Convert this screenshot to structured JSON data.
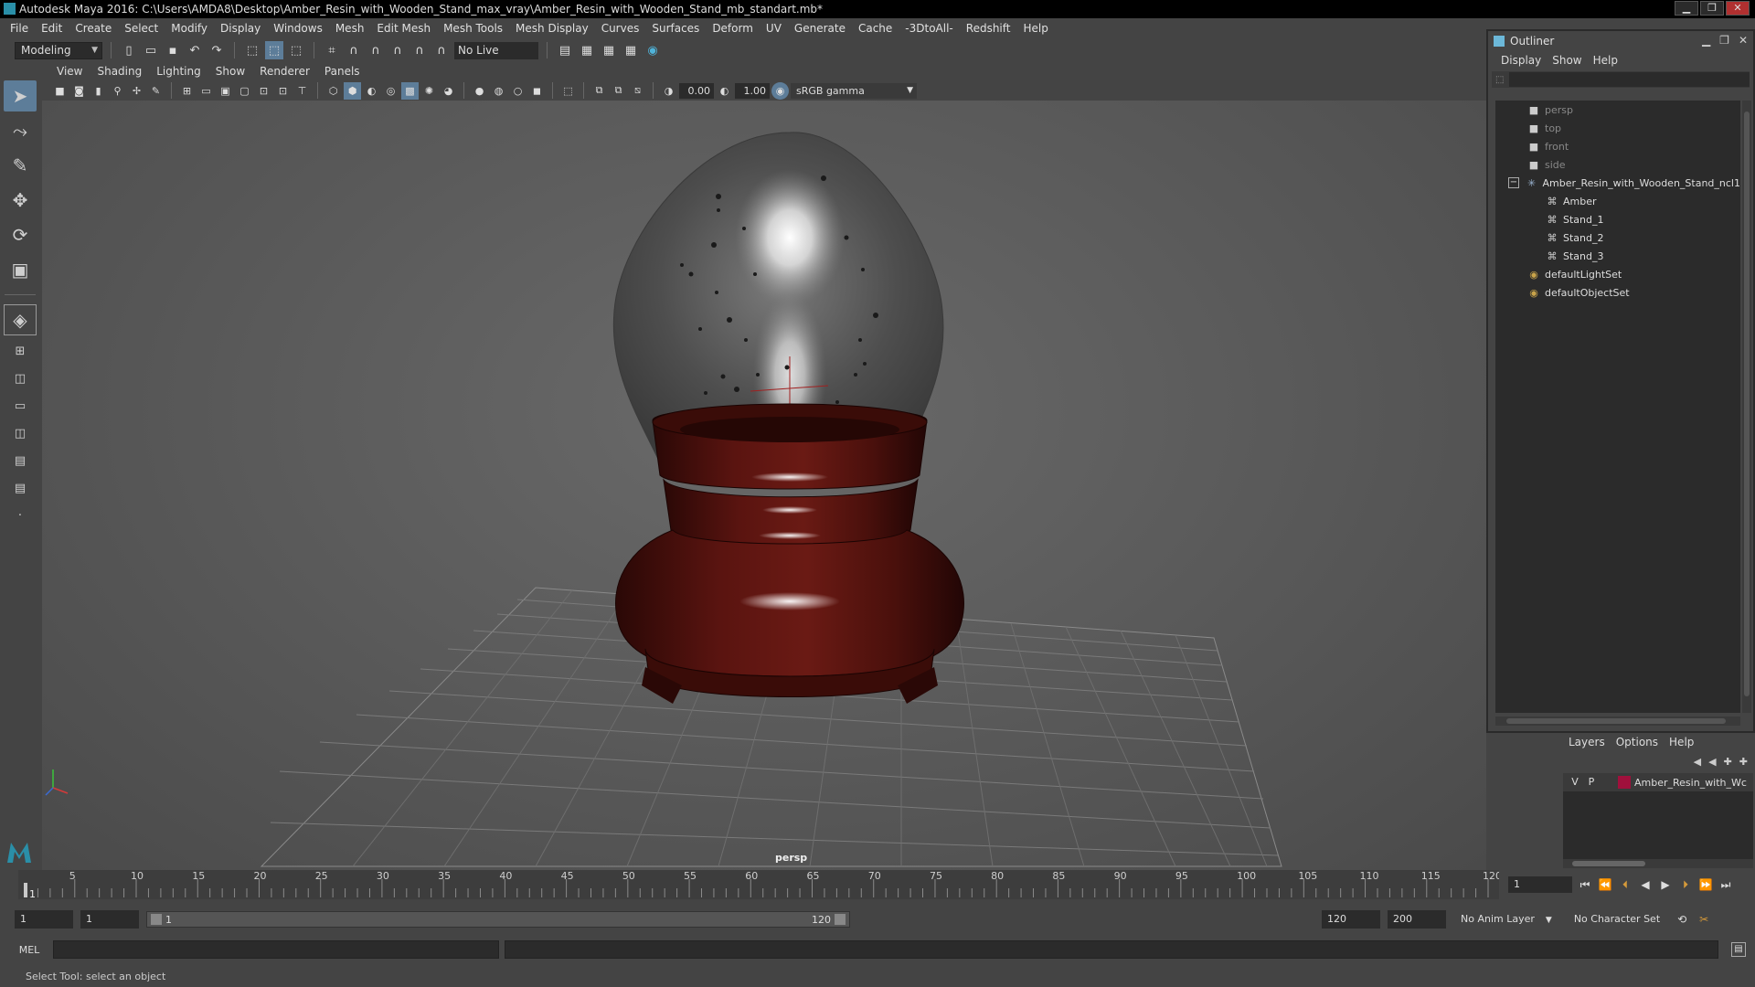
{
  "window": {
    "title": "Autodesk Maya 2016: C:\\Users\\AMDA8\\Desktop\\Amber_Resin_with_Wooden_Stand_max_vray\\Amber_Resin_with_Wooden_Stand_mb_standart.mb*",
    "minimize": "▁",
    "restore": "❐",
    "close": "✕"
  },
  "menubar": [
    "File",
    "Edit",
    "Create",
    "Select",
    "Modify",
    "Display",
    "Windows",
    "Mesh",
    "Edit Mesh",
    "Mesh Tools",
    "Mesh Display",
    "Curves",
    "Surfaces",
    "Deform",
    "UV",
    "Generate",
    "Cache",
    "-3DtoAll-",
    "Redshift",
    "Help"
  ],
  "statusline": {
    "mode": "Modeling",
    "live_surface": "No Live Surface"
  },
  "viewport": {
    "menu": [
      "View",
      "Shading",
      "Lighting",
      "Show",
      "Renderer",
      "Panels"
    ],
    "exposure": "0.00",
    "gamma_value": "1.00",
    "color_space": "sRGB gamma",
    "camera_label": "persp"
  },
  "outliner": {
    "title": "Outliner",
    "menu": [
      "Display",
      "Show",
      "Help"
    ],
    "items": [
      {
        "label": "persp",
        "icon": "camera-icon",
        "indent": 0
      },
      {
        "label": "top",
        "icon": "camera-icon",
        "indent": 0
      },
      {
        "label": "front",
        "icon": "camera-icon",
        "indent": 0
      },
      {
        "label": "side",
        "icon": "camera-icon",
        "indent": 0
      },
      {
        "label": "Amber_Resin_with_Wooden_Stand_ncl1",
        "icon": "group-icon",
        "indent": 0
      },
      {
        "label": "Amber",
        "icon": "mesh-icon",
        "indent": 1
      },
      {
        "label": "Stand_1",
        "icon": "mesh-icon",
        "indent": 1
      },
      {
        "label": "Stand_2",
        "icon": "mesh-icon",
        "indent": 1
      },
      {
        "label": "Stand_3",
        "icon": "mesh-icon",
        "indent": 1
      },
      {
        "label": "defaultLightSet",
        "icon": "set-icon",
        "indent": 0
      },
      {
        "label": "defaultObjectSet",
        "icon": "set-icon",
        "indent": 0
      }
    ]
  },
  "layers": {
    "menu": [
      "Layers",
      "Options",
      "Help"
    ],
    "layer": {
      "v": "V",
      "p": "P",
      "name": "Amber_Resin_with_Wc",
      "color": "#a0103c"
    }
  },
  "timeline": {
    "ticks": [
      "5",
      "10",
      "15",
      "20",
      "25",
      "30",
      "35",
      "40",
      "45",
      "50",
      "55",
      "60",
      "65",
      "70",
      "75",
      "80",
      "85",
      "90",
      "95",
      "100",
      "105",
      "110",
      "115",
      "120"
    ],
    "start_label": "1",
    "current_frame": "1"
  },
  "range": {
    "start": "1",
    "playback_start": "1",
    "range_low": "1",
    "range_high": "120",
    "playback_end": "120",
    "end": "200",
    "anim_layer": "No Anim Layer",
    "character_set": "No Character Set"
  },
  "cmdline": {
    "label": "MEL"
  },
  "helpline": {
    "text": "Select Tool: select an object"
  }
}
